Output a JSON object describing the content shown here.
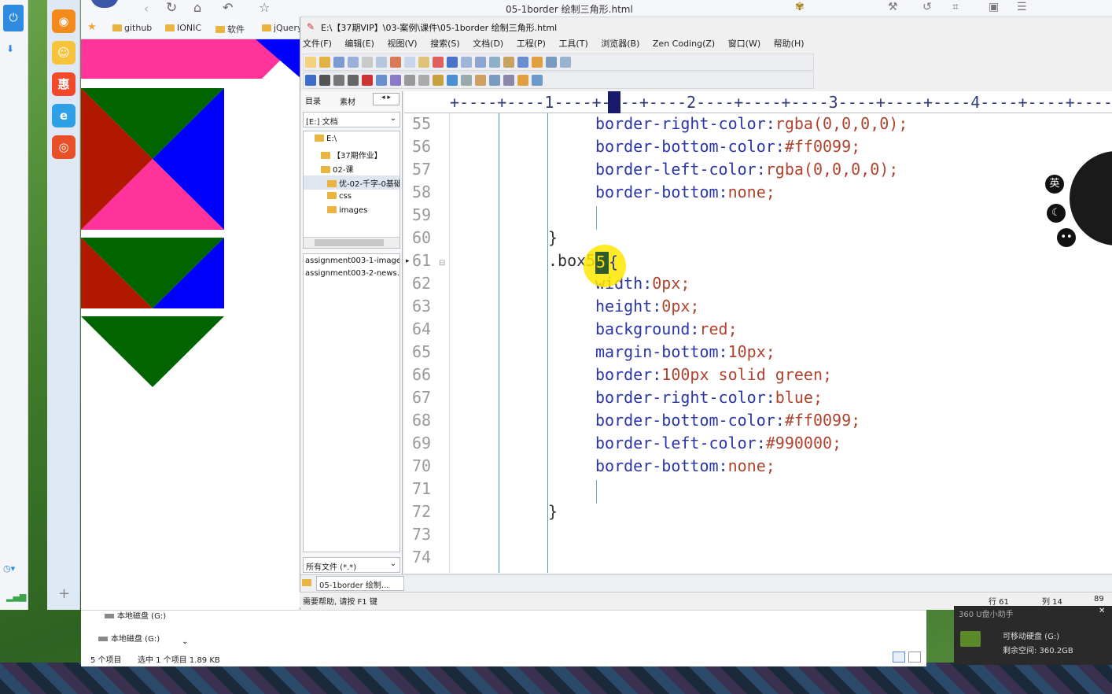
{
  "browser": {
    "bookmarks": [
      "github",
      "IONIC",
      "软件",
      "jQuery"
    ]
  },
  "editor": {
    "window_title": "05-1border 绘制三角形.html",
    "file_path": "E:\\【37期VIP】\\03-案例\\课件\\05-1border 绘制三角形.html",
    "menu": [
      "文件(F)",
      "编辑(E)",
      "视图(V)",
      "搜索(S)",
      "文档(D)",
      "工程(P)",
      "工具(T)",
      "浏览器(B)",
      "Zen Coding(Z)",
      "窗口(W)",
      "帮助(H)"
    ],
    "panel_tabs": [
      "目录",
      "素材"
    ],
    "drive_select": "[E:] 文档",
    "tree": [
      "E:\\",
      "【37期作业】",
      "02-课",
      "优-02-千字-0基础",
      "css",
      "images"
    ],
    "file_list": [
      "assignment003-1-image",
      "assignment003-2-news."
    ],
    "filter_select": "所有文件 (*.*)",
    "open_tab": "05-1border 绘制...",
    "ruler": "+----+----1----+----+----2----+----+----3----+----+----4----+----+----5----+",
    "lines": [
      {
        "n": "55",
        "code": "border-right-color:",
        "val": "rgba(0,0,0,0);"
      },
      {
        "n": "56",
        "code": "border-bottom-color:",
        "val": "#ff0099;"
      },
      {
        "n": "57",
        "code": "border-left-color:",
        "val": "rgba(0,0,0,0);"
      },
      {
        "n": "58",
        "code": "border-bottom:",
        "val": "none;"
      },
      {
        "n": "59",
        "code": "",
        "val": ""
      },
      {
        "n": "60",
        "code": "}",
        "val": ""
      },
      {
        "n": "61",
        "code": ".box5{",
        "val": ""
      },
      {
        "n": "62",
        "code": "width:",
        "val": "0px;"
      },
      {
        "n": "63",
        "code": "height:",
        "val": "0px;"
      },
      {
        "n": "64",
        "code": "background:",
        "val": "red;"
      },
      {
        "n": "65",
        "code": "margin-bottom:",
        "val": "10px;"
      },
      {
        "n": "66",
        "code": "border:",
        "val": "100px solid green;"
      },
      {
        "n": "67",
        "code": "border-right-color:",
        "val": "blue;"
      },
      {
        "n": "68",
        "code": "border-bottom-color:",
        "val": "#ff0099;"
      },
      {
        "n": "69",
        "code": "border-left-color:",
        "val": "#990000;"
      },
      {
        "n": "70",
        "code": "border-bottom:",
        "val": "none;"
      },
      {
        "n": "71",
        "code": "",
        "val": ""
      },
      {
        "n": "72",
        "code": "}",
        "val": ""
      },
      {
        "n": "73",
        "code": "",
        "val": ""
      },
      {
        "n": "74",
        "code": "",
        "val": ""
      }
    ],
    "status_help": "需要帮助, 请按 F1 键",
    "status_row": "行 61",
    "status_col": "列 14",
    "status_num": "89"
  },
  "explorer": {
    "drive1": "本地磁盘 (G:)",
    "drive2": "本地磁盘 (G:)",
    "status": "5 个项目",
    "selected": "选中 1 个项目  1.89 KB"
  },
  "float": {
    "lang_btn": "英"
  },
  "usb": {
    "title": "360 U盘小助手",
    "device": "可移动硬盘 (G:)",
    "space": "剩余空间: 360.2GB"
  },
  "colors": {
    "triangle_green": "#006400",
    "triangle_blue": "#0000ff",
    "triangle_pink": "#ff3399",
    "triangle_darkred": "#b01800",
    "code_property": "#2a35a8",
    "code_value": "#b0432d"
  }
}
